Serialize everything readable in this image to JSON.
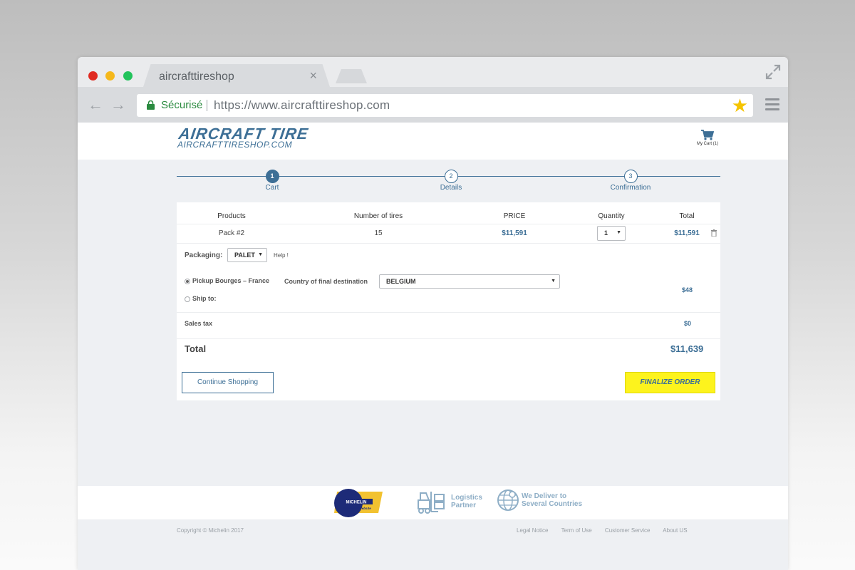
{
  "browser": {
    "tab_title": "aircrafttireshop",
    "tab_close": "×",
    "secure_label": "Sécurisé",
    "url": "https://www.aircrafttireshop.com",
    "back_arrow": "←",
    "forward_arrow": "→",
    "star": "★",
    "colors": {
      "close": "#e02a21",
      "minimize": "#f5b81c",
      "maximize": "#22c35b",
      "star": "#f5c400"
    }
  },
  "header": {
    "logo_title": "AIRCRAFT TIRE",
    "logo_subtitle": "AIRCRAFTTIRESHOP.COM",
    "cart_label": "My Cart (1)"
  },
  "steps": [
    {
      "number": "1",
      "label": "Cart",
      "active": true
    },
    {
      "number": "2",
      "label": "Details",
      "active": false
    },
    {
      "number": "3",
      "label": "Confirmation",
      "active": false
    }
  ],
  "cart": {
    "columns": [
      "Products",
      "Number of tires",
      "PRICE",
      "Quantity",
      "Total"
    ],
    "row": {
      "product": "Pack #2",
      "tires": "15",
      "price": "$11,591",
      "quantity": "1",
      "total": "$11,591"
    },
    "packaging_label": "Packaging:",
    "packaging_value": "PALET",
    "help_link": "Help !",
    "pickup_label": "Pickup Bourges – France",
    "ship_label": "Ship to:",
    "destination_label": "Country of final destination",
    "destination_value": "BELGIUM",
    "shipping_amount": "$48",
    "sales_tax_label": "Sales tax",
    "sales_tax_amount": "$0",
    "total_label": "Total",
    "total_amount": "$11,639",
    "continue_button": "Continue Shopping",
    "finalize_button": "FINALIZE ORDER",
    "caret": "▼"
  },
  "footer": {
    "badge_brand": "MICHELIN",
    "badge_caption": "Approved Website",
    "logistics_line1": "Logistics",
    "logistics_line2": "Partner",
    "deliver_line1": "We Deliver to",
    "deliver_line2": "Several Countries",
    "copyright": "Copyright © Michelin 2017",
    "links": [
      "Legal Notice",
      "Term of Use",
      "Customer Service",
      "About US"
    ]
  },
  "colors": {
    "accent": "#3d6f96",
    "cta": "#fdf31d",
    "footer_text": "#8eaec6"
  }
}
